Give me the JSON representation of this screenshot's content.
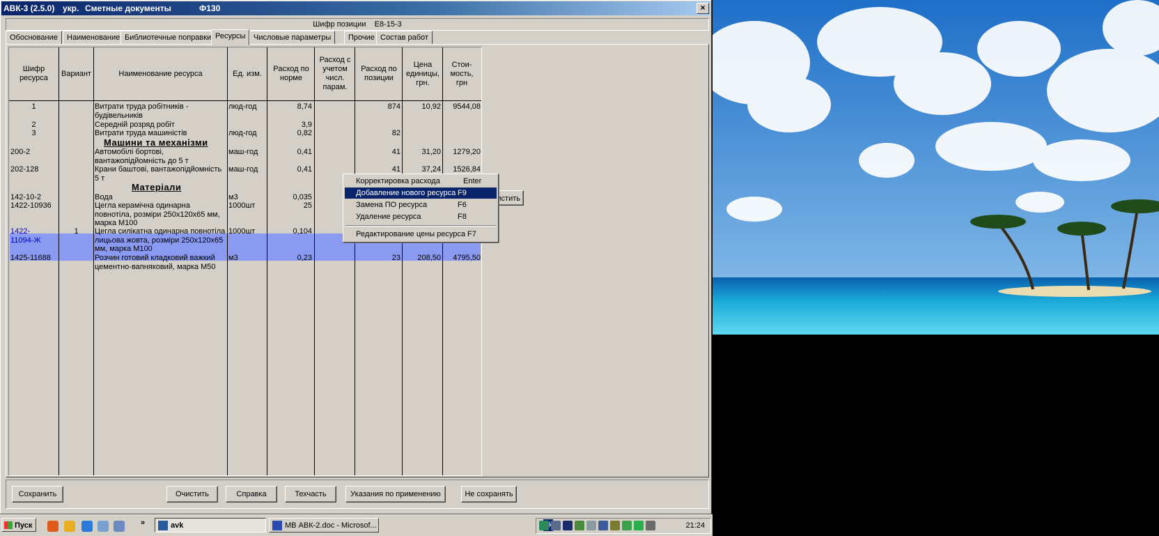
{
  "window": {
    "title_app": "АВК-3 (2.5.0)",
    "title_lang": "укр.",
    "title_doc": "Сметные документы",
    "title_code": "Ф130",
    "close_glyph": "×"
  },
  "position_code": {
    "label": "Шифр позиции",
    "value": "Е8-15-3"
  },
  "tabs": [
    {
      "label": "Обоснование"
    },
    {
      "label": "Наименование"
    },
    {
      "label": "Библиотечные поправки"
    },
    {
      "label": "Ресурсы",
      "active": true
    },
    {
      "label": "Числовые параметры"
    },
    {
      "label": "Прочие"
    },
    {
      "label": "Состав работ"
    }
  ],
  "grid": {
    "headers": {
      "code": "Шифр ресурса",
      "variant": "Вариант",
      "name": "Наименование ресурса",
      "unit": "Ед. изм.",
      "norm": "Расход по норме",
      "param": "Расход с учетом числ. парам.",
      "position": "Расход по позиции",
      "price": "Цена единицы, грн.",
      "cost": "Стои-мость, грн"
    },
    "rows": [
      {
        "code": "1",
        "variant": "",
        "name": "Витрати труда робітників - будівельників",
        "unit": "люд-год",
        "norm": "8,74",
        "param": "",
        "position": "874",
        "price": "10,92",
        "cost": "9544,08"
      },
      {
        "code": "2",
        "variant": "",
        "name": "Середній розряд робіт",
        "unit": "",
        "norm": "3,9",
        "param": "",
        "position": "",
        "price": "",
        "cost": ""
      },
      {
        "code": "3",
        "variant": "",
        "name": "Витрати труда машиністів",
        "unit": "люд-год",
        "norm": "0,82",
        "param": "",
        "position": "82",
        "price": "",
        "cost": ""
      },
      {
        "section": "Машини та механізми"
      },
      {
        "code": "200-2",
        "variant": "",
        "name": "Автомобілі бортові, вантажопідйомність до 5 т",
        "unit": "маш-год",
        "norm": "0,41",
        "param": "",
        "position": "41",
        "price": "31,20",
        "cost": "1279,20"
      },
      {
        "code": "202-128",
        "variant": "",
        "name": "Крани баштові, вантажопідйомність 5 т",
        "unit": "маш-год",
        "norm": "0,41",
        "param": "",
        "position": "41",
        "price": "37,24",
        "cost": "1526,84"
      },
      {
        "section": "Матеріали"
      },
      {
        "code": "142-10-2",
        "variant": "",
        "name": "Вода",
        "unit": "м3",
        "norm": "0,035",
        "param": "",
        "position": "",
        "price": "",
        "cost": ""
      },
      {
        "code": "1422-10936",
        "variant": "",
        "name": "Цегла керамічна одинарна повнотіла, розміри 250х120х65 мм, марка М100",
        "unit": "1000шт",
        "norm": "25",
        "param": "",
        "position": "",
        "price": "",
        "cost": ""
      },
      {
        "code": "1422-11094-Ж",
        "variant": "1",
        "name": "Цегла силікатна одинарна повнотіла лицьова жовта, розміри 250х120х65 мм, марка М100",
        "unit": "1000шт",
        "norm": "0,104",
        "param": "",
        "position": "",
        "price": "",
        "cost": "",
        "selected": true
      },
      {
        "code": "1425-11688",
        "variant": "",
        "name": "Розчин готовий кладковий важкий цементно-вапняковий, марка М50",
        "unit": "м3",
        "norm": "0,23",
        "param": "",
        "position": "23",
        "price": "208,50",
        "cost": "4795,50"
      }
    ]
  },
  "context_menu": {
    "items": [
      {
        "label": "Корректировка расхода",
        "key": "Enter"
      },
      {
        "label": "Добавление нового ресурса",
        "key": "F9",
        "highlighted": true
      },
      {
        "label": "Замена ПО ресурса",
        "key": "F6"
      },
      {
        "label": "Удаление ресурса",
        "key": "F8"
      },
      {
        "label": "Редактирование цены ресурса",
        "key": "F7"
      }
    ]
  },
  "hidden_button_fragment": "чистить",
  "buttons": {
    "save": "Сохранить",
    "clear": "Очистить",
    "help": "Справка",
    "techpart": "Техчасть",
    "guidance": "Указания по применению",
    "no_save": "Не сохранять"
  },
  "taskbar": {
    "start": "Пуск",
    "chevron": "»",
    "tasks": [
      {
        "label": "avk",
        "pressed": true
      },
      {
        "label": "МВ АВК-2.doc - Microsof..."
      }
    ],
    "lang": "Uk",
    "clock": "21:24"
  },
  "colors": {
    "selection": "#8a9af0",
    "title_bar": "#0a246a",
    "menu_highlight": "#0a246a"
  }
}
